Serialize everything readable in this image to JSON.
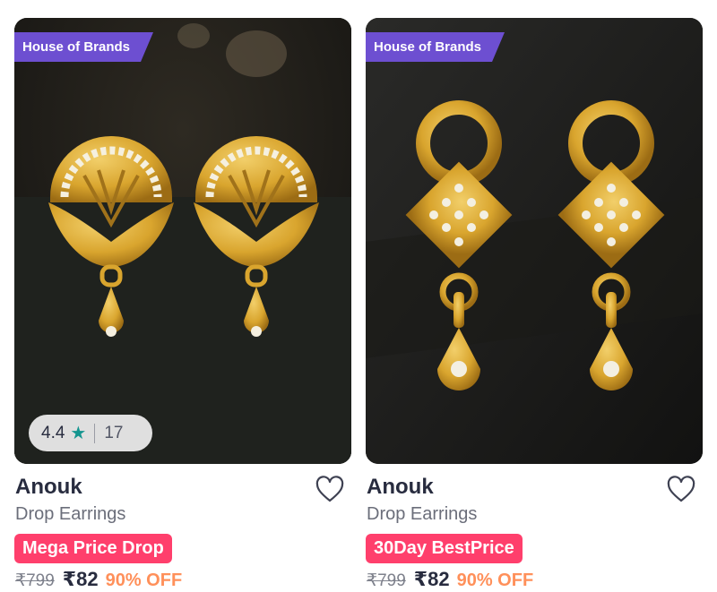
{
  "products": [
    {
      "badge": "House of Brands",
      "rating": "4.4",
      "rating_star": "★",
      "rating_count": "17",
      "brand": "Anouk",
      "name": "Drop Earrings",
      "promo": "Mega Price Drop",
      "mrp": "₹799",
      "price": "₹82",
      "discount": "90% OFF"
    },
    {
      "badge": "House of Brands",
      "brand": "Anouk",
      "name": "Drop Earrings",
      "promo": "30Day BestPrice",
      "mrp": "₹799",
      "price": "₹82",
      "discount": "90% OFF"
    }
  ],
  "colors": {
    "brand_tag": "#6d4fd1",
    "promo": "#ff3f6c",
    "discount": "#ff905a",
    "rating_star": "#14958f",
    "gold": "#d9a52e"
  },
  "icons": {
    "wishlist": "heart-outline-icon",
    "rating": "star-icon"
  }
}
